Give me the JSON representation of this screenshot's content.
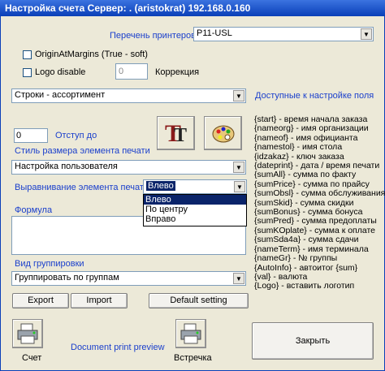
{
  "window": {
    "title": "Настройка счета  Сервер: . (aristokrat) 192.168.0.160"
  },
  "printers": {
    "label": "Перечень принтеров",
    "selected": "P11-USL"
  },
  "options": {
    "origin_at_margins": "OriginAtMargins (True - soft)",
    "logo_disable": "Logo disable",
    "correction_value": "0",
    "correction_label": "Коррекция"
  },
  "section_combo": {
    "selected": "Строки - ассортимент"
  },
  "available_fields_label": "Доступные к настройке поля",
  "indent": {
    "value": "0",
    "label": "Отступ до"
  },
  "style_label": "Стиль размера элемента печати",
  "style_combo": {
    "selected": "Настройка пользователя"
  },
  "align": {
    "label": "Выравнивание элемента печати",
    "selected": "Влево",
    "options": [
      "Влево",
      "По центру",
      "Вправо"
    ]
  },
  "formula_label": "Формула",
  "grouping": {
    "label": "Вид группировки",
    "selected": "Группировать по группам"
  },
  "buttons": {
    "export": "Export",
    "import": "Import",
    "default_setting": "Default setting",
    "close": "Закрыть"
  },
  "bottom": {
    "bill": "Счет",
    "preview": "Document print preview",
    "meeting": "Встречка"
  },
  "fields": [
    "{start} - время начала заказа",
    "{nameorg} - имя организации",
    "{nameof} - имя официанта",
    "{namestol} - имя стола",
    "{idzakaz} - ключ заказа",
    "{dateprint} - дата / время печати",
    "{sumAll} - сумма по факту",
    "{sumPrice} - сумма по прайсу",
    "{sumObsl} - сумма обслуживания",
    "{sumSkid} - сумма скидки",
    "{sumBonus} - сумма бонуса",
    "{sumPred} - сумма предоплаты",
    "{sumKOplate} - сумма к оплате",
    "{sumSda4a} - сумма сдачи",
    "{nameTerm} - имя терминала",
    "{nameGr} - № группы",
    "{AutoInfo} - автоитог {sum}",
    "{val} - валюта",
    "{Logo} - вставить логотип"
  ]
}
